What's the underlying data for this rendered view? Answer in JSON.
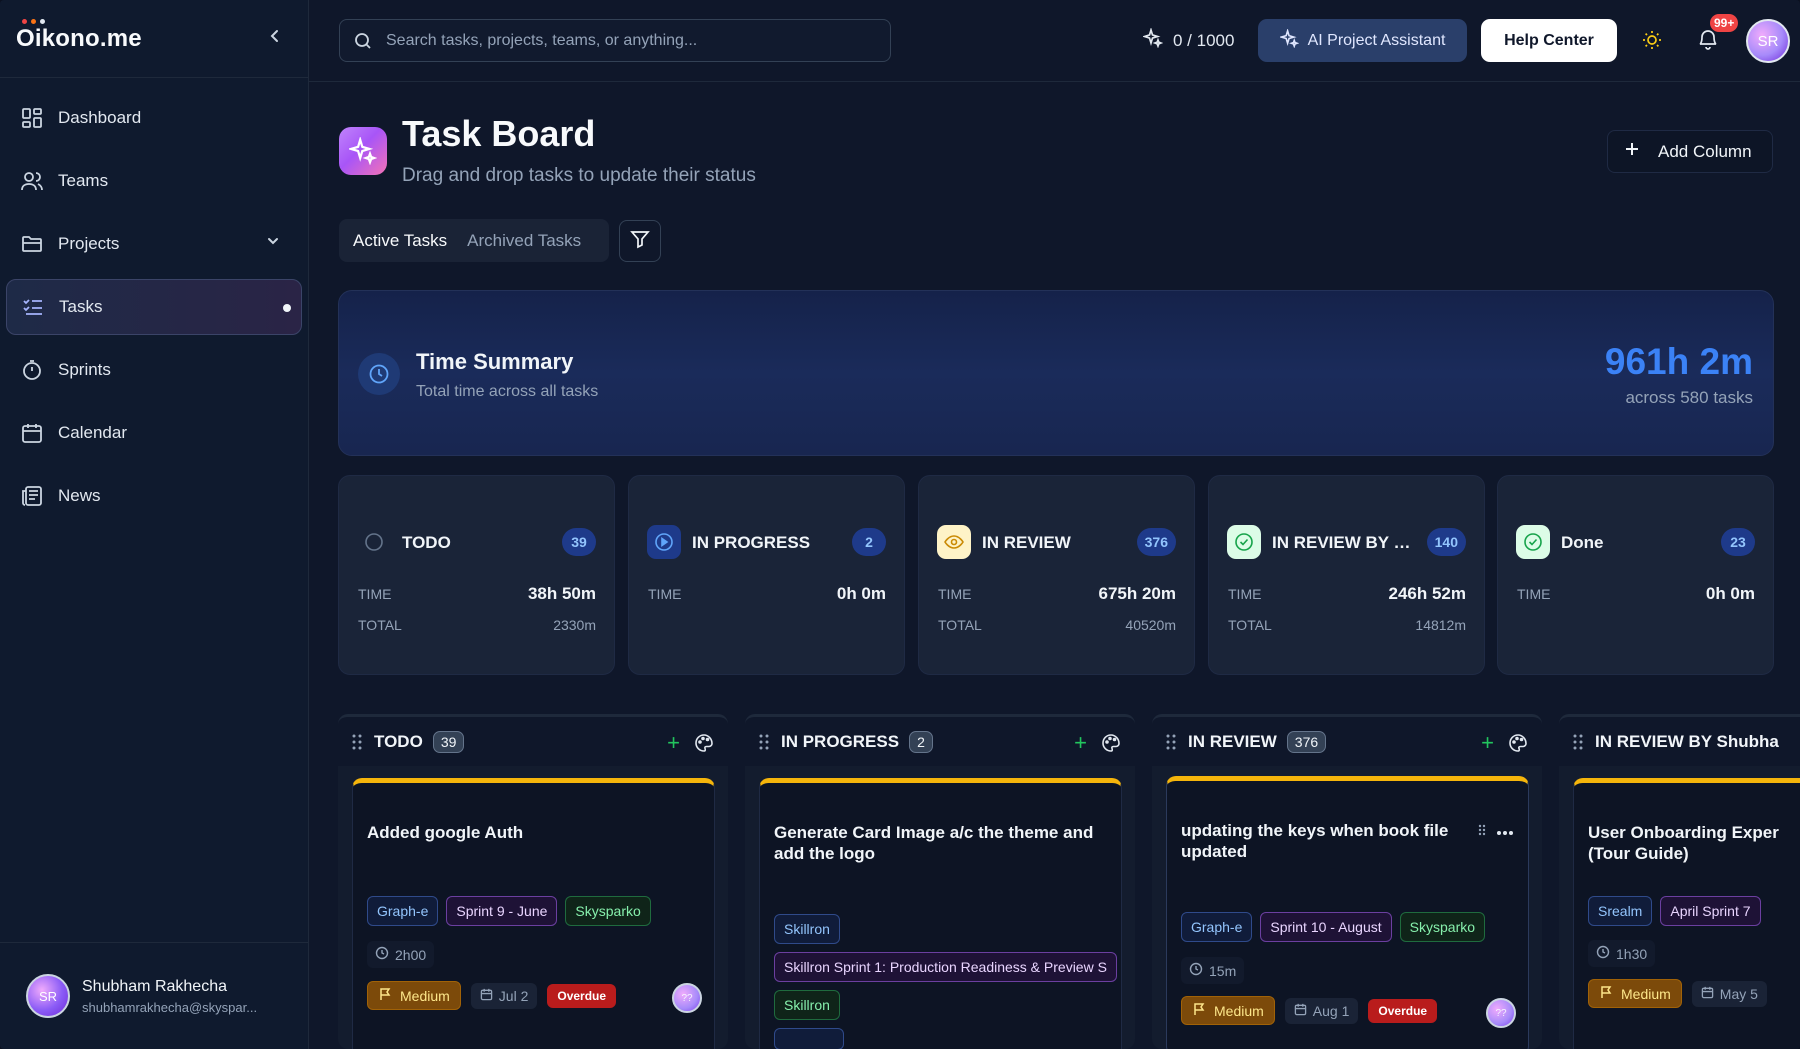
{
  "app": {
    "name": "Oikono.me"
  },
  "sidebar": {
    "items": [
      {
        "label": "Dashboard",
        "icon": "dashboard-icon"
      },
      {
        "label": "Teams",
        "icon": "users-icon"
      },
      {
        "label": "Projects",
        "icon": "folder-icon"
      },
      {
        "label": "Tasks",
        "icon": "tasks-icon"
      },
      {
        "label": "Sprints",
        "icon": "timer-icon"
      },
      {
        "label": "Calendar",
        "icon": "calendar-icon"
      },
      {
        "label": "News",
        "icon": "newspaper-icon"
      }
    ],
    "active_item": "Tasks",
    "user": {
      "initials": "SR",
      "name": "Shubham Rakhecha",
      "email": "shubhamrakhecha@skyspar..."
    }
  },
  "header": {
    "search_placeholder": "Search tasks, projects, teams, or anything...",
    "credits": "0 / 1000",
    "ai_button": "AI Project Assistant",
    "help_button": "Help Center",
    "notification_badge": "99+",
    "user_initials": "SR"
  },
  "page": {
    "title": "Task Board",
    "subtitle": "Drag and drop tasks to update their status",
    "add_column": "Add Column",
    "tabs": [
      "Active Tasks",
      "Archived Tasks"
    ],
    "active_tab": "Active Tasks"
  },
  "summary": {
    "title": "Time Summary",
    "subtitle": "Total time across all tasks",
    "total": "961h 2m",
    "count": "across 580 tasks"
  },
  "stats": [
    {
      "name": "TODO",
      "count": "39",
      "time_label": "TIME",
      "time": "38h 50m",
      "total_label": "TOTAL",
      "total": "2330m",
      "icon": "circle-icon",
      "icon_color": "#94a3b8"
    },
    {
      "name": "IN PROGRESS",
      "count": "2",
      "time_label": "TIME",
      "time": "0h 0m",
      "total_label": "",
      "total": "",
      "icon": "play-circle-icon",
      "icon_color": "#3b82f6"
    },
    {
      "name": "IN REVIEW",
      "count": "376",
      "time_label": "TIME",
      "time": "675h 20m",
      "total_label": "TOTAL",
      "total": "40520m",
      "icon": "eye-icon",
      "icon_color": "#eab308"
    },
    {
      "name": "IN REVIEW BY S...",
      "count": "140",
      "time_label": "TIME",
      "time": "246h 52m",
      "total_label": "TOTAL",
      "total": "14812m",
      "icon": "check-circle-icon",
      "icon_color": "#22c55e"
    },
    {
      "name": "Done",
      "count": "23",
      "time_label": "TIME",
      "time": "0h 0m",
      "total_label": "",
      "total": "",
      "icon": "check-circle-icon",
      "icon_color": "#22c55e"
    }
  ],
  "columns": [
    {
      "name": "TODO",
      "count": "39",
      "task": {
        "title": "Added google Auth",
        "tags": [
          {
            "label": "Graph-e",
            "color": "blue"
          },
          {
            "label": "Sprint 9 - June",
            "color": "purple"
          },
          {
            "label": "Skysparko",
            "color": "green"
          }
        ],
        "estimate": "2h00",
        "priority": "Medium",
        "due": "Jul 2",
        "status": "Overdue",
        "assignee": "??"
      }
    },
    {
      "name": "IN PROGRESS",
      "count": "2",
      "task": {
        "title": "Generate Card Image a/c the theme and add the logo",
        "tags": [
          {
            "label": "Skillron",
            "color": "blue"
          },
          {
            "label": "Skillron Sprint 1: Production Readiness & Preview S",
            "color": "purple"
          },
          {
            "label": "Skillron",
            "color": "green"
          }
        ]
      }
    },
    {
      "name": "IN REVIEW",
      "count": "376",
      "task": {
        "title": "updating the keys when book file updated",
        "tags": [
          {
            "label": "Graph-e",
            "color": "blue"
          },
          {
            "label": "Sprint 10 - August",
            "color": "purple"
          },
          {
            "label": "Skysparko",
            "color": "green"
          }
        ],
        "estimate": "15m",
        "priority": "Medium",
        "due": "Aug 1",
        "status": "Overdue",
        "assignee": "??"
      }
    },
    {
      "name": "IN REVIEW BY Shubha",
      "count": "",
      "task": {
        "title": "User Onboarding Exper (Tour Guide)",
        "tags": [
          {
            "label": "Srealm",
            "color": "blue"
          },
          {
            "label": "April Sprint 7",
            "color": "purple"
          }
        ],
        "estimate": "1h30",
        "priority": "Medium",
        "due": "May 5"
      }
    }
  ],
  "colors": {
    "accent": "#3b82f6",
    "priority": "#a16207",
    "overdue": "#b91c1c",
    "card_top": "#f5b50b"
  }
}
